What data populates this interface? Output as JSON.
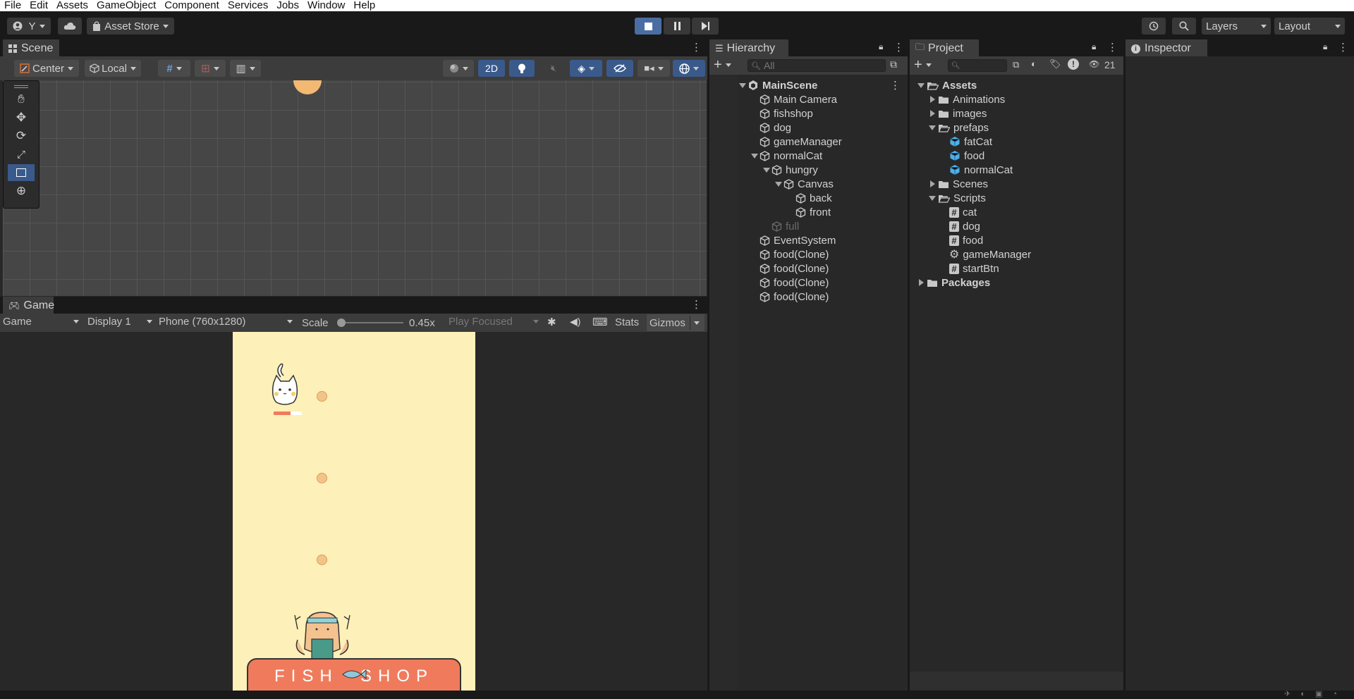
{
  "menu": [
    "File",
    "Edit",
    "Assets",
    "GameObject",
    "Component",
    "Services",
    "Jobs",
    "Window",
    "Help"
  ],
  "toolbar": {
    "account_label": "Y",
    "asset_store_label": "Asset Store",
    "layers_label": "Layers",
    "layout_label": "Layout"
  },
  "scene": {
    "tab": "Scene",
    "pivot_label": "Center",
    "space_label": "Local",
    "mode_2d": "2D"
  },
  "game": {
    "tab": "Game",
    "view_label": "Game",
    "display_label": "Display 1",
    "resolution_label": "Phone (760x1280)",
    "scale_label": "Scale",
    "scale_value": "0.45x",
    "play_mode_label": "Play Focused",
    "stats_label": "Stats",
    "gizmos_label": "Gizmos",
    "shop_text": "FISH  SHOP"
  },
  "hierarchy": {
    "tab": "Hierarchy",
    "search_placeholder": "All",
    "items": [
      {
        "label": "MainScene",
        "depth": 0,
        "expanded": true,
        "kind": "scene"
      },
      {
        "label": "Main Camera",
        "depth": 1,
        "kind": "go"
      },
      {
        "label": "fishshop",
        "depth": 1,
        "kind": "go"
      },
      {
        "label": "dog",
        "depth": 1,
        "kind": "go"
      },
      {
        "label": "gameManager",
        "depth": 1,
        "kind": "go"
      },
      {
        "label": "normalCat",
        "depth": 1,
        "expanded": true,
        "kind": "go"
      },
      {
        "label": "hungry",
        "depth": 2,
        "expanded": true,
        "kind": "go"
      },
      {
        "label": "Canvas",
        "depth": 3,
        "expanded": true,
        "kind": "go"
      },
      {
        "label": "back",
        "depth": 4,
        "kind": "go"
      },
      {
        "label": "front",
        "depth": 4,
        "kind": "go"
      },
      {
        "label": "full",
        "depth": 2,
        "kind": "go",
        "inactive": true
      },
      {
        "label": "EventSystem",
        "depth": 1,
        "kind": "go"
      },
      {
        "label": "food(Clone)",
        "depth": 1,
        "kind": "go"
      },
      {
        "label": "food(Clone)",
        "depth": 1,
        "kind": "go"
      },
      {
        "label": "food(Clone)",
        "depth": 1,
        "kind": "go"
      },
      {
        "label": "food(Clone)",
        "depth": 1,
        "kind": "go"
      }
    ]
  },
  "project": {
    "tab": "Project",
    "hidden_count": "21",
    "items": [
      {
        "label": "Assets",
        "depth": 0,
        "expanded": true,
        "kind": "folder-open",
        "bold": true
      },
      {
        "label": "Animations",
        "depth": 1,
        "collapsed": true,
        "kind": "folder"
      },
      {
        "label": "images",
        "depth": 1,
        "collapsed": true,
        "kind": "folder"
      },
      {
        "label": "prefaps",
        "depth": 1,
        "expanded": true,
        "kind": "folder-open"
      },
      {
        "label": "fatCat",
        "depth": 2,
        "kind": "prefab"
      },
      {
        "label": "food",
        "depth": 2,
        "kind": "prefab"
      },
      {
        "label": "normalCat",
        "depth": 2,
        "kind": "prefab"
      },
      {
        "label": "Scenes",
        "depth": 1,
        "collapsed": true,
        "kind": "folder"
      },
      {
        "label": "Scripts",
        "depth": 1,
        "expanded": true,
        "kind": "folder-open"
      },
      {
        "label": "cat",
        "depth": 2,
        "kind": "script"
      },
      {
        "label": "dog",
        "depth": 2,
        "kind": "script"
      },
      {
        "label": "food",
        "depth": 2,
        "kind": "script"
      },
      {
        "label": "gameManager",
        "depth": 2,
        "kind": "gear"
      },
      {
        "label": "startBtn",
        "depth": 2,
        "kind": "script"
      },
      {
        "label": "Packages",
        "depth": 0,
        "collapsed": true,
        "kind": "folder",
        "bold": true
      }
    ]
  },
  "inspector": {
    "tab": "Inspector"
  },
  "colors": {
    "accent": "#3a5a8c",
    "game_bg": "#fdf0b8",
    "shop_red": "#f07b5c",
    "prefab_blue": "#4fb0e8"
  }
}
